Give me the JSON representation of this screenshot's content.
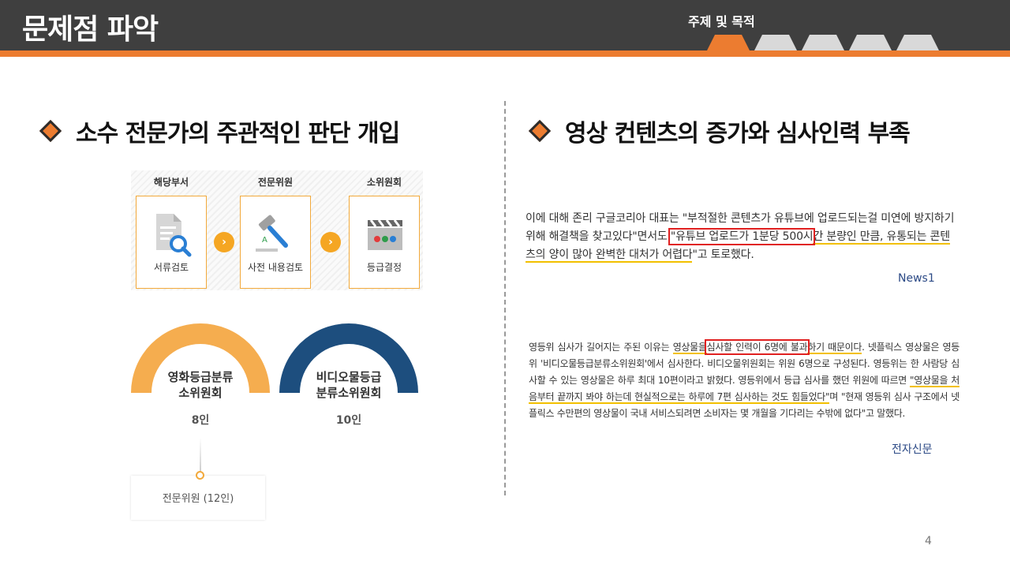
{
  "header": {
    "title": "문제점 파악",
    "tab_label": "주제 및 목적"
  },
  "colors": {
    "accent": "#ec7c30",
    "header_bg": "#3f3f3f",
    "tab_inactive": "#d9d9d9"
  },
  "left": {
    "section_title": "소수 전문가의 주관적인 판단 개입",
    "flow": {
      "steps": [
        {
          "head": "해당부서",
          "label": "서류검토",
          "icon": "document-search-icon"
        },
        {
          "head": "전문위원",
          "label": "사전 내용검토",
          "icon": "gavel-icon"
        },
        {
          "head": "소위원회",
          "label": "등급결정",
          "icon": "clapperboard-icon"
        }
      ]
    },
    "committees": [
      {
        "line1": "영화등급분류",
        "line2": "소위원회",
        "count": "8인",
        "color": "#f5ad4f"
      },
      {
        "line1": "비디오물등급",
        "line2": "분류소위원회",
        "count": "10인",
        "color": "#1d4e7e"
      }
    ],
    "experts": "전문위원 (12인)"
  },
  "right": {
    "section_title": "영상 컨텐츠의 증가와 심사인력 부족",
    "news1": {
      "part1": "이에 대해 존리 구글코리아 대표는 \"부적절한 콘텐츠가 유튜브에 업로드되는걸 미연에 방지하기 위해 해결책을 찾고있다\"면서도 ",
      "boxed": "\"유튜브 업로드가 1분당 500시",
      "underlined": "간 분량인 만큼, 유통되는 콘텐츠의 양이 많아 완벽한 대처가 어렵다",
      "part2": "\"고 토로했다.",
      "source": "News1"
    },
    "news2": {
      "p1": "영등위 심사가 길어지는 주된 이유는 ",
      "u1": "영상물을",
      "boxed": "심사할 인력이 6명에 불과",
      "u2": "하기 때문이다",
      "p2": ". 넷플릭스 영상물은 영등위 '비디오물등급분류소위원회'에서 심사한다. 비디오물위원회는 위원 6명으로 구성된다. 영등위는 한 사람당 심사할 수 있는 영상물은 하루 최대 10편이라고 밝혔다. 영등위에서 등급 심사를 했던 위원에 따르면 ",
      "u3": "\"영상물을 처음부터 끝까지 봐야 하는데 현실적으로는 하루에 7편 심사하는 것도 힘들었다\"",
      "p3": "며 \"현재 영등위 심사 구조에서 넷플릭스 수만편의 영상물이 국내 서비스되려면 소비자는 몇 개월을 기다리는 수밖에 없다\"고 말했다.",
      "source": "전자신문"
    }
  },
  "page_number": "4"
}
